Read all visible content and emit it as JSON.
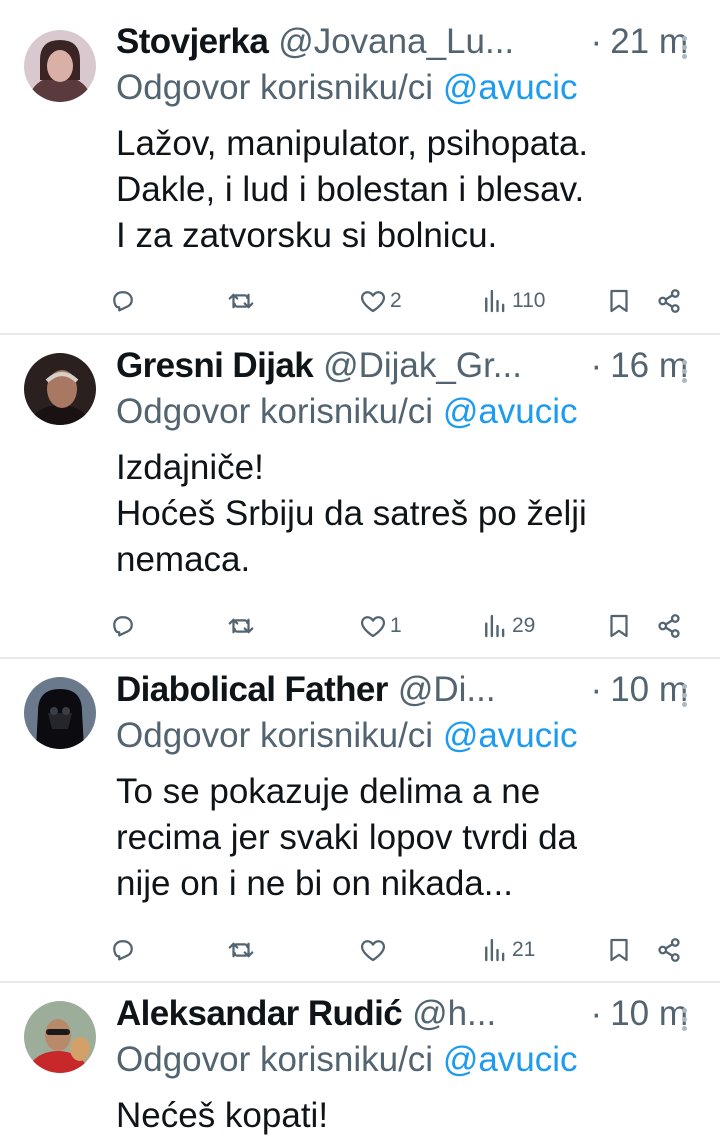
{
  "reply_prefix": "Odgovor korisniku/ci",
  "tweets": [
    {
      "name": "Stovjerka",
      "handle": "@Jovana_Lu...",
      "dot": "·",
      "time": "21 m",
      "mention": "@avucic",
      "lines": [
        "Lažov, manipulator, psihopata.",
        "Dakle, i lud i bolestan i blesav.",
        "I za zatvorsku si bolnicu."
      ],
      "likes": "2",
      "views": "110"
    },
    {
      "name": "Gresni Dijak",
      "handle": "@Dijak_Gr...",
      "dot": "·",
      "time": "16 m",
      "mention": "@avucic",
      "lines": [
        "Izdajniče!",
        "Hoćeš Srbiju da satreš po želji",
        "nemaca."
      ],
      "likes": "1",
      "views": "29"
    },
    {
      "name": "Diabolical Father",
      "handle": "@Di...",
      "dot": "·",
      "time": "10 m",
      "mention": "@avucic",
      "lines": [
        "To se pokazuje delima a ne",
        "recima jer svaki lopov tvrdi da",
        "nije on i ne bi on nikada..."
      ],
      "likes": "",
      "views": "21"
    },
    {
      "name": "Aleksandar Rudić",
      "handle": "@h...",
      "dot": "·",
      "time": "10 m",
      "mention": "@avucic",
      "lines": [
        "Nećeš kopati!"
      ],
      "likes": "",
      "views": ""
    }
  ],
  "colors": {
    "text": "#0f1419",
    "muted": "#536471",
    "link": "#1d9bf0",
    "divider": "#e6e9ec"
  },
  "icons": [
    "reply-icon",
    "retweet-icon",
    "like-icon",
    "views-icon",
    "bookmark-icon",
    "share-icon",
    "more-icon"
  ]
}
